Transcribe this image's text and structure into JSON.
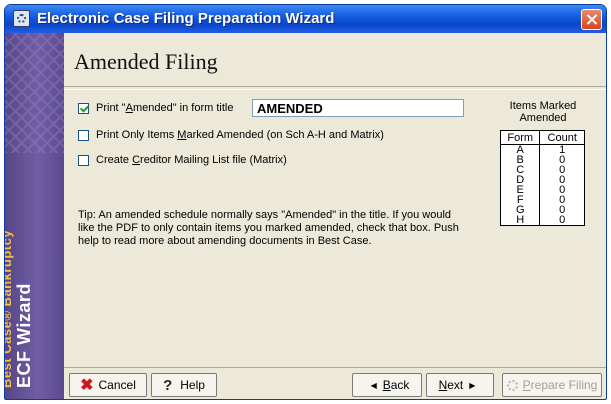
{
  "window": {
    "title": "Electronic Case Filing Preparation Wizard"
  },
  "sidebar": {
    "brand_line1": "Best Case® Bankruptcy",
    "brand_line2": "ECF Wizard"
  },
  "main": {
    "page_title": "Amended Filing",
    "options": [
      {
        "label_pre": "Print \"",
        "label_ul": "A",
        "label_post": "mended\" in form title",
        "checked": true
      },
      {
        "label_pre": "Print Only Items ",
        "label_ul": "M",
        "label_post": "arked Amended (on Sch A-H and Matrix)",
        "checked": false
      },
      {
        "label_pre": "Create ",
        "label_ul": "C",
        "label_post": "reditor Mailing List file (Matrix)",
        "checked": false
      }
    ],
    "amended_title_value": "AMENDED",
    "tip": "Tip:  An amended schedule normally says \"Amended\" in the title. If you would like the PDF to only contain items you marked amended, check that box. Push help to read more about amending documents in Best Case."
  },
  "items_marked": {
    "title_line1": "Items Marked",
    "title_line2": "Amended",
    "columns": [
      "Form",
      "Count"
    ],
    "rows": [
      [
        "A",
        "1"
      ],
      [
        "B",
        "0"
      ],
      [
        "C",
        "0"
      ],
      [
        "D",
        "0"
      ],
      [
        "E",
        "0"
      ],
      [
        "F",
        "0"
      ],
      [
        "G",
        "0"
      ],
      [
        "H",
        "0"
      ]
    ]
  },
  "footer": {
    "cancel_label": "Cancel",
    "help_label": "Help",
    "back_ul": "B",
    "back_rest": "ack",
    "next_ul": "N",
    "next_rest": "ext",
    "prepare_ul": "P",
    "prepare_rest": "repare Filing"
  },
  "colors": {
    "titlebar": "#1256df",
    "sidebar": "#6f5ea3",
    "brand_accent": "#f2c04a",
    "cancel_icon": "#cc1a1a",
    "checkmark": "#21a121"
  },
  "icons": [
    "app-gear-icon",
    "close-icon",
    "checkbox-check-icon",
    "cancel-x-icon",
    "help-question-icon",
    "back-arrow-icon",
    "next-arrow-icon",
    "prepare-gear-icon"
  ]
}
